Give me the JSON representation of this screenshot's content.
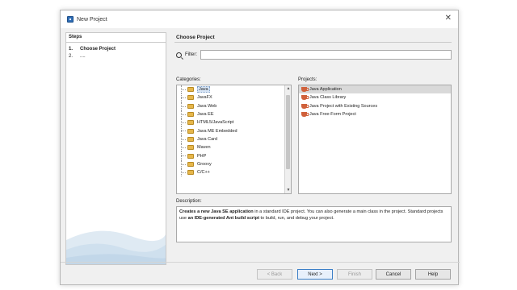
{
  "window": {
    "title": "New Project",
    "close_glyph": "✕"
  },
  "steps": {
    "header": "Steps",
    "items": [
      {
        "num": "1.",
        "label": "Choose Project"
      },
      {
        "num": "2.",
        "label": "...."
      }
    ]
  },
  "main": {
    "title": "Choose Project",
    "filter_label": "Filter:",
    "filter_value": "",
    "categories_label": "Categories:",
    "projects_label": "Projects:",
    "categories": [
      "Java",
      "JavaFX",
      "Java Web",
      "Java EE",
      "HTML5/JavaScript",
      "Java ME Embedded",
      "Java Card",
      "Maven",
      "PHP",
      "Groovy",
      "C/C++"
    ],
    "selected_category": "Java",
    "projects": [
      "Java Application",
      "Java Class Library",
      "Java Project with Existing Sources",
      "Java Free-Form Project"
    ],
    "selected_project": "Java Application",
    "description_label": "Description:",
    "description": {
      "part1": "Creates a new Java SE application",
      "part2": " in a standard IDE project. You can also generate a main class in the project. Standard projects use ",
      "part3": "an IDE-generated Ant build script",
      "part4": " to build, run, and debug your project."
    }
  },
  "buttons": {
    "back": "< Back",
    "next": "Next >",
    "finish": "Finish",
    "cancel": "Cancel",
    "help": "Help"
  },
  "icons": {
    "window": "netbeans-icon",
    "search": "search-icon",
    "folder": "folder-icon",
    "project": "java-cup-icon"
  },
  "colors": {
    "folder": "#e6b64a",
    "java_cup": "#d0613b",
    "selection": "#d9d9d9",
    "primary_border": "#3c7fc7"
  }
}
